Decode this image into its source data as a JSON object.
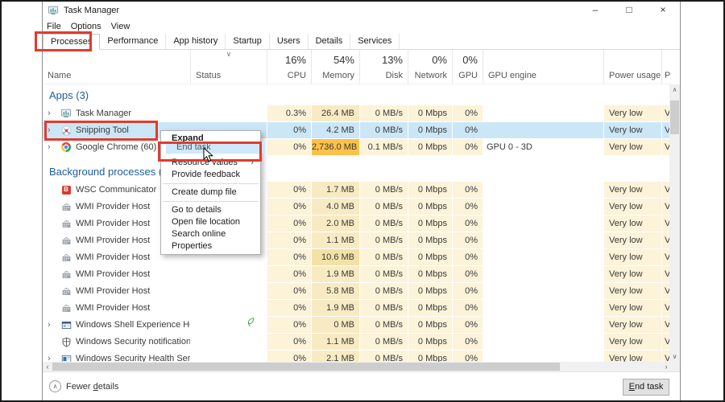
{
  "window": {
    "title": "Task Manager"
  },
  "titlebar": {
    "controls": [
      {
        "name": "minimize",
        "glyph": "–"
      },
      {
        "name": "maximize",
        "glyph": "□"
      },
      {
        "name": "close",
        "glyph": "×"
      }
    ]
  },
  "menubar": {
    "items": [
      "File",
      "Options",
      "View"
    ]
  },
  "tabs": [
    {
      "label": "Processes",
      "selected": true
    },
    {
      "label": "Performance",
      "selected": false
    },
    {
      "label": "App history",
      "selected": false
    },
    {
      "label": "Startup",
      "selected": false
    },
    {
      "label": "Users",
      "selected": false
    },
    {
      "label": "Details",
      "selected": false
    },
    {
      "label": "Services",
      "selected": false
    }
  ],
  "columns": {
    "name_header": "Name",
    "status_header": "Status",
    "sort_chevron": "∨",
    "usage": [
      {
        "pct": "16%",
        "label": "CPU"
      },
      {
        "pct": "54%",
        "label": "Memory"
      },
      {
        "pct": "13%",
        "label": "Disk"
      },
      {
        "pct": "0%",
        "label": "Network"
      },
      {
        "pct": "0%",
        "label": "GPU"
      }
    ],
    "gpu_engine_header": "GPU engine",
    "power_header": "Power usage",
    "power_trend_header": "Pow"
  },
  "sections": [
    {
      "label": "Apps (3)",
      "rows": [
        {
          "name": "Task Manager",
          "icon": "task-manager-icon",
          "expander": true,
          "status_icon": null,
          "cpu": "0.3%",
          "memory": "26.4 MB",
          "mem_shade": "mem",
          "disk": "0 MB/s",
          "network": "0 Mbps",
          "gpu": "0%",
          "gpu_engine": "",
          "power": "Very low",
          "power_trend": "V",
          "selected": false
        },
        {
          "name": "Snipping Tool",
          "icon": "snipping-tool-icon",
          "expander": true,
          "status_icon": null,
          "cpu": "0%",
          "memory": "4.2 MB",
          "mem_shade": "mem",
          "disk": "0 MB/s",
          "network": "0 Mbps",
          "gpu": "0%",
          "gpu_engine": "",
          "power": "Very low",
          "power_trend": "V",
          "selected": true
        },
        {
          "name": "Google Chrome (60)",
          "icon": "chrome-icon",
          "expander": true,
          "status_icon": null,
          "cpu": "0%",
          "memory": "2,736.0 MB",
          "mem_shade": "mem-hi",
          "disk": "0.1 MB/s",
          "network": "0 Mbps",
          "gpu": "0%",
          "gpu_engine": "GPU 0 - 3D",
          "power": "Very low",
          "power_trend": "V",
          "selected": false
        }
      ]
    },
    {
      "label": "Background processes (",
      "rows": [
        {
          "name": "WSC Communicator",
          "icon": "wsc-communicator-icon",
          "expander": false,
          "status_icon": null,
          "cpu": "0%",
          "memory": "1.7 MB",
          "mem_shade": "mem",
          "disk": "0 MB/s",
          "network": "0 Mbps",
          "gpu": "0%",
          "gpu_engine": "",
          "power": "Very low",
          "power_trend": "V",
          "selected": false
        },
        {
          "name": "WMI Provider Host",
          "icon": "wmi-provider-icon",
          "expander": false,
          "status_icon": null,
          "cpu": "0%",
          "memory": "4.0 MB",
          "mem_shade": "mem",
          "disk": "0 MB/s",
          "network": "0 Mbps",
          "gpu": "0%",
          "gpu_engine": "",
          "power": "Very low",
          "power_trend": "V",
          "selected": false
        },
        {
          "name": "WMI Provider Host",
          "icon": "wmi-provider-icon",
          "expander": false,
          "status_icon": null,
          "cpu": "0%",
          "memory": "2.0 MB",
          "mem_shade": "mem",
          "disk": "0 MB/s",
          "network": "0 Mbps",
          "gpu": "0%",
          "gpu_engine": "",
          "power": "Very low",
          "power_trend": "V",
          "selected": false
        },
        {
          "name": "WMI Provider Host",
          "icon": "wmi-provider-icon",
          "expander": false,
          "status_icon": null,
          "cpu": "0%",
          "memory": "1.1 MB",
          "mem_shade": "mem",
          "disk": "0 MB/s",
          "network": "0 Mbps",
          "gpu": "0%",
          "gpu_engine": "",
          "power": "Very low",
          "power_trend": "V",
          "selected": false
        },
        {
          "name": "WMI Provider Host",
          "icon": "wmi-provider-icon",
          "expander": false,
          "status_icon": null,
          "cpu": "0%",
          "memory": "10.6 MB",
          "mem_shade": "mem-md",
          "disk": "0 MB/s",
          "network": "0 Mbps",
          "gpu": "0%",
          "gpu_engine": "",
          "power": "Very low",
          "power_trend": "V",
          "selected": false
        },
        {
          "name": "WMI Provider Host",
          "icon": "wmi-provider-icon",
          "expander": false,
          "status_icon": null,
          "cpu": "0%",
          "memory": "1.9 MB",
          "mem_shade": "mem",
          "disk": "0 MB/s",
          "network": "0 Mbps",
          "gpu": "0%",
          "gpu_engine": "",
          "power": "Very low",
          "power_trend": "V",
          "selected": false
        },
        {
          "name": "WMI Provider Host",
          "icon": "wmi-provider-icon",
          "expander": false,
          "status_icon": null,
          "cpu": "0%",
          "memory": "5.8 MB",
          "mem_shade": "mem",
          "disk": "0 MB/s",
          "network": "0 Mbps",
          "gpu": "0%",
          "gpu_engine": "",
          "power": "Very low",
          "power_trend": "V",
          "selected": false
        },
        {
          "name": "WMI Provider Host",
          "icon": "wmi-provider-icon",
          "expander": false,
          "status_icon": null,
          "cpu": "0%",
          "memory": "1.9 MB",
          "mem_shade": "mem",
          "disk": "0 MB/s",
          "network": "0 Mbps",
          "gpu": "0%",
          "gpu_engine": "",
          "power": "Very low",
          "power_trend": "V",
          "selected": false
        },
        {
          "name": "Windows Shell Experience Host",
          "icon": "shell-experience-icon",
          "expander": true,
          "status_icon": "suspended-leaf-icon",
          "cpu": "0%",
          "memory": "0 MB",
          "mem_shade": "mem",
          "disk": "0 MB/s",
          "network": "0 Mbps",
          "gpu": "0%",
          "gpu_engine": "",
          "power": "Very low",
          "power_trend": "V",
          "selected": false
        },
        {
          "name": "Windows Security notification i...",
          "icon": "security-shield-icon",
          "expander": false,
          "status_icon": null,
          "cpu": "0%",
          "memory": "1.1 MB",
          "mem_shade": "mem",
          "disk": "0 MB/s",
          "network": "0 Mbps",
          "gpu": "0%",
          "gpu_engine": "",
          "power": "Very low",
          "power_trend": "V",
          "selected": false
        },
        {
          "name": "Windows Security Health Service",
          "icon": "security-health-icon",
          "expander": true,
          "status_icon": null,
          "cpu": "0%",
          "memory": "2.1 MB",
          "mem_shade": "mem",
          "disk": "0 MB/s",
          "network": "0 Mbps",
          "gpu": "0%",
          "gpu_engine": "",
          "power": "Very low",
          "power_trend": "V",
          "selected": false
        }
      ]
    }
  ],
  "context_menu": {
    "submenu_arrow": "›",
    "items": [
      {
        "label": "Expand",
        "bold": true
      },
      {
        "label": "End task",
        "highlighted": true
      },
      {
        "label": "Resource values",
        "submenu": true
      },
      {
        "label": "Provide feedback"
      },
      {
        "separator": true
      },
      {
        "label": "Create dump file"
      },
      {
        "separator": true
      },
      {
        "label": "Go to details"
      },
      {
        "label": "Open file location"
      },
      {
        "label": "Search online"
      },
      {
        "label": "Properties"
      }
    ]
  },
  "scrollbars": {
    "up": "∧",
    "down": "∨",
    "left": "‹",
    "right": "›"
  },
  "footer": {
    "details_label_parts": [
      "Fewer ",
      "d",
      "etails"
    ],
    "details_chevron": "∧",
    "end_task_parts": [
      "E",
      "nd task"
    ]
  },
  "colors": {
    "annotation_red": "#e23b2d",
    "selection_blue": "#cbe7f7",
    "menu_highlight": "#cde9fb",
    "heat_yellow": "#fcf3d9",
    "heat_memory": "#f8ebc3",
    "heat_memory_high": "#fcc14a",
    "section_header_blue": "#1d5c9e"
  }
}
